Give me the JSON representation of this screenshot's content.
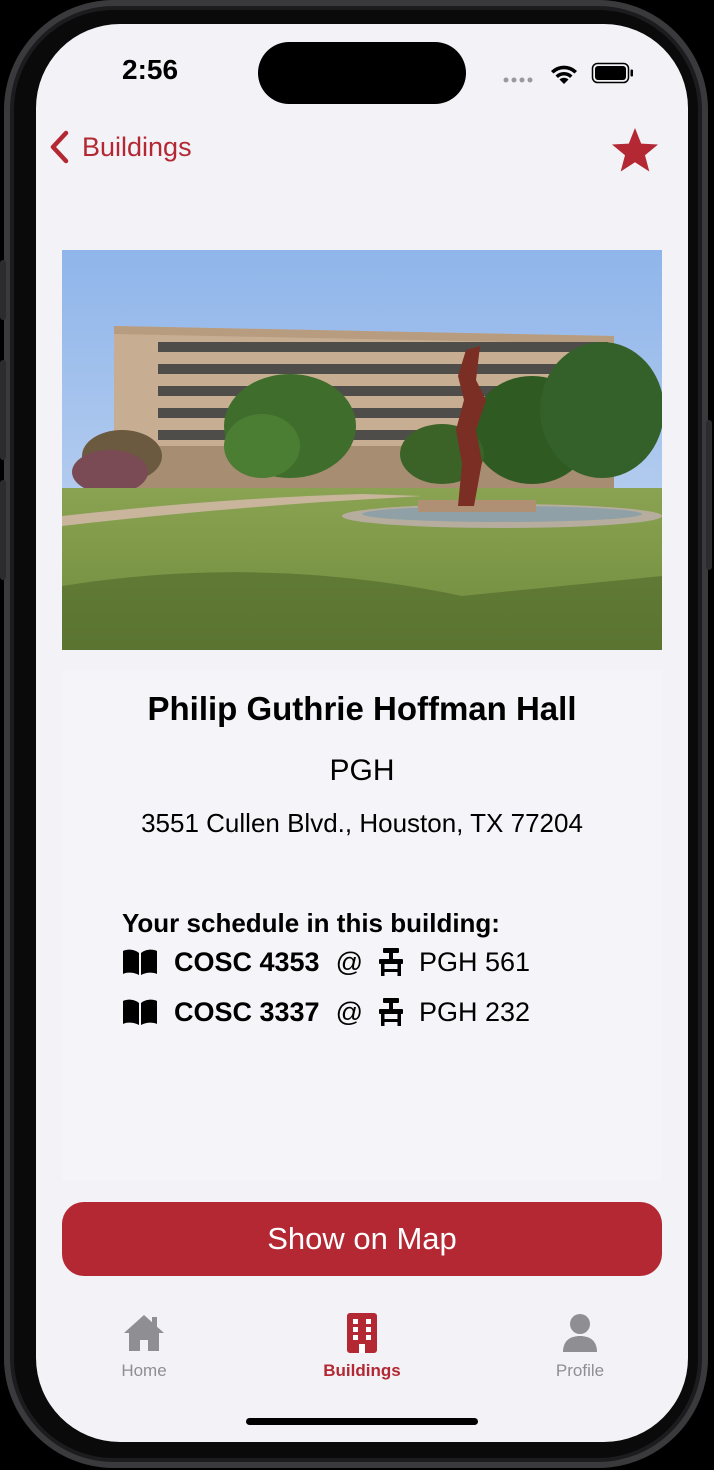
{
  "status_bar": {
    "time": "2:56"
  },
  "nav": {
    "back_label": "Buildings",
    "favorite_icon": "star-icon"
  },
  "building": {
    "name": "Philip Guthrie Hoffman Hall",
    "code": "PGH",
    "address": "3551 Cullen Blvd., Houston, TX 77204"
  },
  "schedule": {
    "heading": "Your schedule in this building:",
    "items": [
      {
        "course": "COSC 4353",
        "at": "@",
        "room": "PGH 561"
      },
      {
        "course": "COSC 3337",
        "at": "@",
        "room": "PGH 232"
      }
    ]
  },
  "actions": {
    "show_on_map": "Show on Map"
  },
  "tabbar": {
    "items": [
      {
        "label": "Home",
        "icon": "house-icon"
      },
      {
        "label": "Buildings",
        "icon": "building-icon"
      },
      {
        "label": "Profile",
        "icon": "person-icon"
      }
    ]
  },
  "colors": {
    "accent": "#b32833",
    "inactive": "#8e8e93",
    "background": "#f2f2f7"
  }
}
